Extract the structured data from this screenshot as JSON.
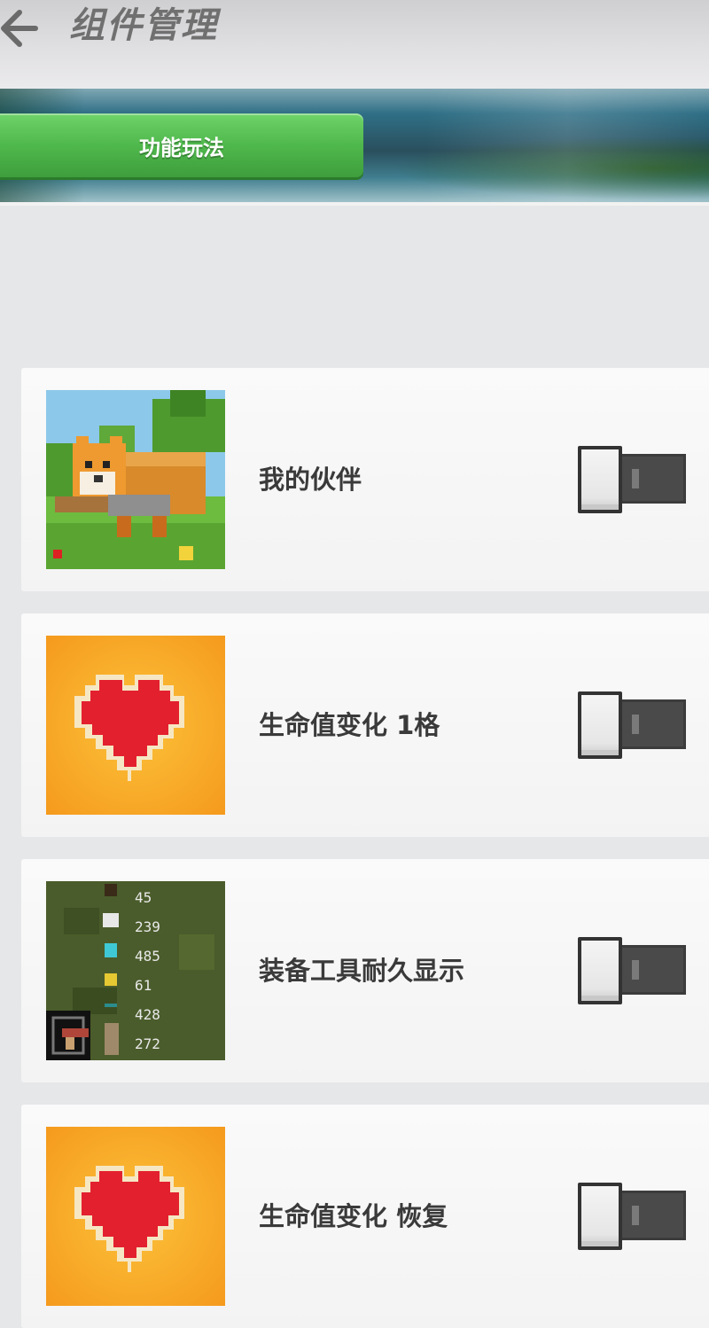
{
  "header": {
    "back_icon": "back-arrow-icon",
    "title": "组件管理"
  },
  "banner": {
    "active_tab_label": "功能玩法"
  },
  "components": [
    {
      "label": "我的伙伴",
      "thumbnail": "fox-companion-image",
      "enabled": false
    },
    {
      "label": "生命值变化 1格",
      "thumbnail": "heart-icon",
      "enabled": false
    },
    {
      "label": "装备工具耐久显示",
      "thumbnail": "durability-hud-image",
      "enabled": false,
      "durability_values": [
        "45",
        "239",
        "485",
        "61",
        "428",
        "272"
      ]
    },
    {
      "label": "生命值变化 恢复",
      "thumbnail": "heart-icon",
      "enabled": false
    }
  ],
  "colors": {
    "tab_green": "#4fb84c",
    "heart_red": "#e3202e",
    "heart_bg": "#f5a623",
    "toggle_off": "#4a4a4a"
  }
}
